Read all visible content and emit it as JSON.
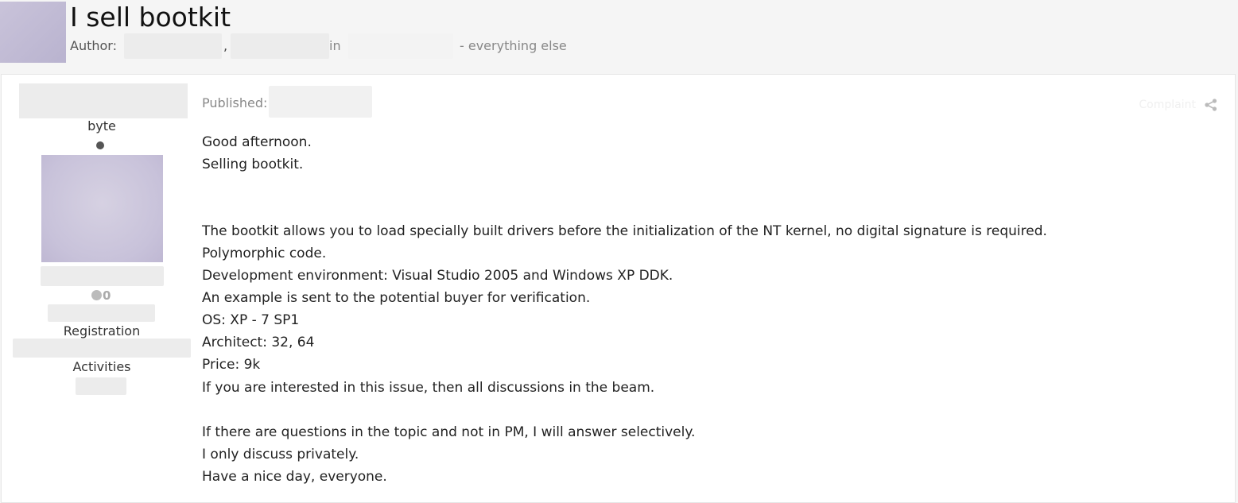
{
  "topic": {
    "title": "I sell bootkit",
    "author_label": "Author:",
    "comma": ",",
    "in_label": "in",
    "forum_suffix": "- everything else"
  },
  "author": {
    "rank": "byte",
    "reputation": "0",
    "registration_label": "Registration",
    "activities_label": "Activities"
  },
  "post": {
    "published_label": "Published:",
    "complaint_label": "Complaint",
    "lines": [
      "Good afternoon.",
      "Selling bootkit.",
      "The bootkit allows you to load specially built drivers before the initialization of the NT kernel, no digital signature is required.",
      "Polymorphic code.",
      "Development environment: Visual Studio 2005 and Windows XP DDK.",
      "An example is sent to the potential buyer for verification.",
      "OS: XP - 7 SP1",
      "Architect: 32, 64",
      "Price: 9k",
      "If you are interested in this issue, then all discussions in the beam.",
      "If there are questions in the topic and not in PM, I will answer selectively.",
      "I only discuss privately.",
      "Have a nice day, everyone."
    ]
  },
  "icons": {
    "share": "share-icon"
  }
}
